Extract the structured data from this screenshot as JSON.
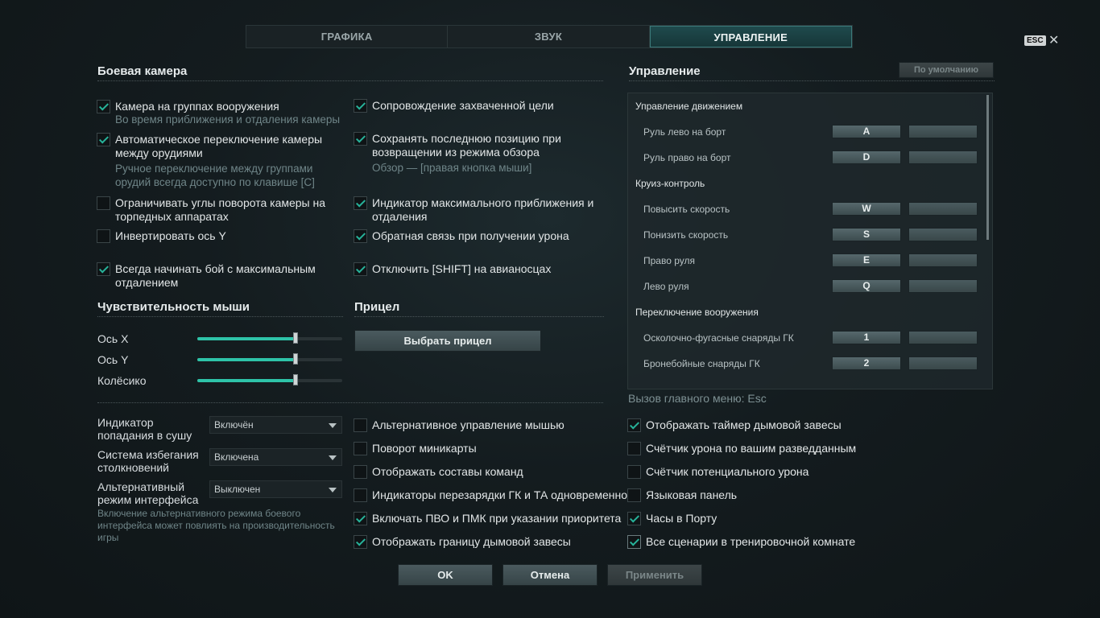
{
  "tabs": [
    {
      "label": "ГРАФИКА",
      "active": false
    },
    {
      "label": "ЗВУК",
      "active": false
    },
    {
      "label": "УПРАВЛЕНИЕ",
      "active": true
    }
  ],
  "esc": {
    "badge": "ESC",
    "close": "✕"
  },
  "battle_camera": {
    "title": "Боевая камера",
    "left": [
      {
        "label": "Камера на группах вооружения",
        "sub": "Во время приближения и отдаления камеры",
        "checked": true
      },
      {
        "label": "Автоматическое переключение камеры между орудиями",
        "sub": "Ручное переключение между группами орудий всегда доступно по клавише [C]",
        "checked": true
      },
      {
        "label": "Ограничивать углы поворота камеры на торпедных аппаратах",
        "checked": false
      },
      {
        "label": "Инвертировать ось Y",
        "checked": false
      },
      {
        "label": "Всегда начинать бой с максимальным отдалением",
        "checked": true
      }
    ],
    "right": [
      {
        "label": "Сопровождение захваченной цели",
        "checked": true
      },
      {
        "label": "Сохранять последнюю позицию при возвращении из режима обзора",
        "sub": "Обзор — [правая кнопка мыши]",
        "checked": true
      },
      {
        "label": "Индикатор максимального приближения и отдаления",
        "checked": true
      },
      {
        "label": "Обратная связь при получении урона",
        "checked": true
      },
      {
        "label": "Отключить [SHIFT] на авианосцах",
        "checked": true
      }
    ]
  },
  "mouse": {
    "title": "Чувствительность мыши",
    "sliders": [
      {
        "label": "Ось X",
        "value": 0.67
      },
      {
        "label": "Ось Y",
        "value": 0.67
      },
      {
        "label": "Колёсико",
        "value": 0.67
      }
    ]
  },
  "sight": {
    "title": "Прицел",
    "button": "Выбрать прицел"
  },
  "dropdowns": [
    {
      "label": "Индикатор попадания в сушу",
      "value": "Включён"
    },
    {
      "label": "Система избегания столкновений",
      "value": "Включена"
    },
    {
      "label": "Альтернативный режим интерфейса",
      "value": "Выключен"
    }
  ],
  "alt_note": "Включение альтернативного режима боевого интерфейса может повлиять на производительность игры",
  "mid_checks": [
    {
      "label": "Альтернативное управление мышью",
      "checked": false
    },
    {
      "label": "Поворот миникарты",
      "checked": false
    },
    {
      "label": "Отображать составы команд",
      "checked": false
    },
    {
      "label": "Индикаторы перезарядки ГК и ТА одновременно",
      "checked": false
    },
    {
      "label": "Включать ПВО и ПМК при указании приоритета",
      "checked": true
    },
    {
      "label": "Отображать границу дымовой завесы",
      "checked": true
    }
  ],
  "right_checks": [
    {
      "label": "Отображать таймер дымовой завесы",
      "checked": true
    },
    {
      "label": "Счётчик урона по вашим разведданным",
      "checked": false
    },
    {
      "label": "Счётчик потенциального урона",
      "checked": false
    },
    {
      "label": "Языковая панель",
      "checked": false
    },
    {
      "label": "Часы в Порту",
      "checked": true
    },
    {
      "label": "Все сценарии в тренировочной комнате",
      "checked": true
    }
  ],
  "controls": {
    "title": "Управление",
    "default_button": "По умолчанию",
    "menu_hint": "Вызов главного меню: Esc",
    "groups": [
      {
        "title": "Управление движением",
        "items": [
          {
            "label": "Руль лево на борт",
            "key": "A",
            "alt": ""
          },
          {
            "label": "Руль право на борт",
            "key": "D",
            "alt": ""
          }
        ]
      },
      {
        "title": "Круиз-контроль",
        "items": [
          {
            "label": "Повысить скорость",
            "key": "W",
            "alt": ""
          },
          {
            "label": "Понизить скорость",
            "key": "S",
            "alt": ""
          },
          {
            "label": "Право руля",
            "key": "E",
            "alt": ""
          },
          {
            "label": "Лево руля",
            "key": "Q",
            "alt": ""
          }
        ]
      },
      {
        "title": "Переключение вооружения",
        "items": [
          {
            "label": "Осколочно-фугасные снаряды ГК",
            "key": "1",
            "alt": ""
          },
          {
            "label": "Бронебойные снаряды ГК",
            "key": "2",
            "alt": ""
          }
        ]
      }
    ]
  },
  "footer": {
    "ok": "OK",
    "cancel": "Отмена",
    "apply": "Применить"
  }
}
